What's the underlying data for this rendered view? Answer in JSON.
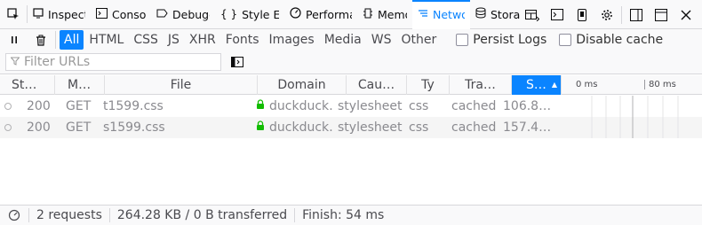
{
  "devtools": {
    "tabs": [
      {
        "label": "Inspect",
        "icon": "inspector-icon"
      },
      {
        "label": "Conso",
        "icon": "console-icon"
      },
      {
        "label": "Debugg",
        "icon": "debugger-icon"
      },
      {
        "label": "Style Edit",
        "icon": "style-editor-icon"
      },
      {
        "label": "Performan",
        "icon": "performance-icon"
      },
      {
        "label": "Memo",
        "icon": "memory-icon"
      },
      {
        "label": "Netwo",
        "icon": "network-icon"
      },
      {
        "label": "Storag",
        "icon": "storage-icon"
      }
    ],
    "active_tab": "Netwo"
  },
  "filters": {
    "types": [
      "All",
      "HTML",
      "CSS",
      "JS",
      "XHR",
      "Fonts",
      "Images",
      "Media",
      "WS",
      "Other"
    ],
    "active_type": "All",
    "persist_logs_label": "Persist Logs",
    "disable_cache_label": "Disable cache",
    "url_placeholder": "Filter URLs"
  },
  "table": {
    "columns": {
      "status": "St…",
      "method": "M…",
      "file": "File",
      "domain": "Domain",
      "cause": "Cau…",
      "type": "Ty",
      "transferred": "Tra…",
      "size": "S…"
    },
    "timeline": {
      "t0": "0 ms",
      "t1": "80 ms"
    },
    "rows": [
      {
        "status": "200",
        "method": "GET",
        "file": "t1599.css",
        "domain": "duckduck…",
        "cause": "stylesheet",
        "type": "css",
        "transferred": "cached",
        "size": "106.8…"
      },
      {
        "status": "200",
        "method": "GET",
        "file": "s1599.css",
        "domain": "duckduck…",
        "cause": "stylesheet",
        "type": "css",
        "transferred": "cached",
        "size": "157.4…"
      }
    ]
  },
  "footer": {
    "requests": "2 requests",
    "transferred": "264.28 KB / 0 B transferred",
    "finish": "Finish: 54 ms"
  },
  "colors": {
    "accent": "#0a84ff",
    "secure": "#12bc00"
  }
}
